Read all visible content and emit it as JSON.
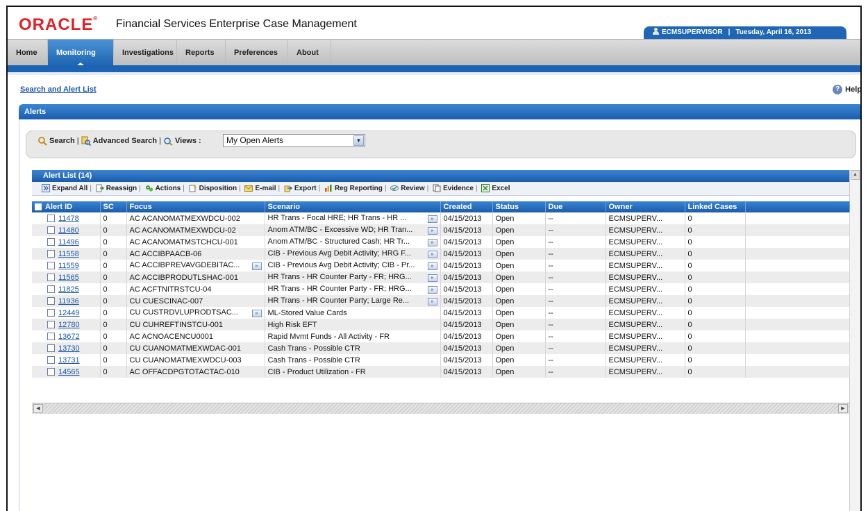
{
  "header": {
    "logo": "ORACLE",
    "app_title": "Financial Services Enterprise Case Management",
    "user": "ECMSUPERVISOR",
    "date": "Tuesday, April 16, 2013"
  },
  "nav": {
    "tabs": [
      {
        "label": "Home"
      },
      {
        "label": "Monitoring",
        "active": true
      },
      {
        "label": "Investigations"
      },
      {
        "label": "Reports"
      },
      {
        "label": "Preferences"
      },
      {
        "label": "About"
      }
    ]
  },
  "breadcrumb": "Search and Alert List",
  "help_label": "Help",
  "alerts_panel": {
    "title": "Alerts",
    "search_label": "Search",
    "advanced_search_label": "Advanced Search",
    "views_label": "Views :",
    "views_selected": "My Open Alerts"
  },
  "alert_list": {
    "title": "Alert List",
    "count": "(14)",
    "toolbar": {
      "expand_all": "Expand All",
      "reassign": "Reassign",
      "actions": "Actions",
      "disposition": "Disposition",
      "email": "E-mail",
      "export": "Export",
      "reg_reporting": "Reg Reporting",
      "review": "Review",
      "evidence": "Evidence",
      "excel": "Excel"
    },
    "columns": {
      "alert_id": "Alert ID",
      "sc": "SC",
      "focus": "Focus",
      "scenario": "Scenario",
      "created": "Created",
      "status": "Status",
      "due": "Due",
      "owner": "Owner",
      "linked_cases": "Linked Cases"
    },
    "rows": [
      {
        "id": "11478",
        "sc": "0",
        "focus": "AC ACANOMATMEXWDCU-002",
        "focus_more": false,
        "scenario": "HR Trans - Focal HRE; HR Trans - HR ...",
        "scenario_more": true,
        "created": "04/15/2013",
        "status": "Open",
        "due": "--",
        "owner": "ECMSUPERV...",
        "linked": "0"
      },
      {
        "id": "11480",
        "sc": "0",
        "focus": "AC ACANOMATMEXWDCU-02",
        "focus_more": false,
        "scenario": "Anom ATM/BC - Excessive WD; HR Tran...",
        "scenario_more": true,
        "created": "04/15/2013",
        "status": "Open",
        "due": "--",
        "owner": "ECMSUPERV...",
        "linked": "0"
      },
      {
        "id": "11496",
        "sc": "0",
        "focus": "AC ACANOMATMSTCHCU-001",
        "focus_more": false,
        "scenario": "Anom ATM/BC - Structured Cash; HR Tr...",
        "scenario_more": true,
        "created": "04/15/2013",
        "status": "Open",
        "due": "--",
        "owner": "ECMSUPERV...",
        "linked": "0"
      },
      {
        "id": "11558",
        "sc": "0",
        "focus": "AC ACCIBPAACB-06",
        "focus_more": false,
        "scenario": "CIB - Previous Avg Debit Activity; HRG F...",
        "scenario_more": true,
        "created": "04/15/2013",
        "status": "Open",
        "due": "--",
        "owner": "ECMSUPERV...",
        "linked": "0"
      },
      {
        "id": "11559",
        "sc": "0",
        "focus": "AC ACCIBPREVAVGDEBITAC...",
        "focus_more": true,
        "scenario": "CIB - Previous Avg Debit Activity; CIB - Pr...",
        "scenario_more": true,
        "created": "04/15/2013",
        "status": "Open",
        "due": "--",
        "owner": "ECMSUPERV...",
        "linked": "0"
      },
      {
        "id": "11565",
        "sc": "0",
        "focus": "AC ACCIBPRODUTLSHAC-001",
        "focus_more": false,
        "scenario": "HR Trans - HR Counter Party - FR; HRG...",
        "scenario_more": true,
        "created": "04/15/2013",
        "status": "Open",
        "due": "--",
        "owner": "ECMSUPERV...",
        "linked": "0"
      },
      {
        "id": "11825",
        "sc": "0",
        "focus": "AC ACFTNITRSTCU-04",
        "focus_more": false,
        "scenario": "HR Trans - HR Counter Party - FR; HRG...",
        "scenario_more": true,
        "created": "04/15/2013",
        "status": "Open",
        "due": "--",
        "owner": "ECMSUPERV...",
        "linked": "0"
      },
      {
        "id": "11936",
        "sc": "0",
        "focus": "CU CUESCINAC-007",
        "focus_more": false,
        "scenario": "HR Trans - HR Counter Party; Large Re...",
        "scenario_more": true,
        "created": "04/15/2013",
        "status": "Open",
        "due": "--",
        "owner": "ECMSUPERV...",
        "linked": "0"
      },
      {
        "id": "12449",
        "sc": "0",
        "focus": "CU CUSTRDVLUPRODTSAC...",
        "focus_more": true,
        "scenario": "ML-Stored Value Cards",
        "scenario_more": false,
        "created": "04/15/2013",
        "status": "Open",
        "due": "--",
        "owner": "ECMSUPERV...",
        "linked": "0"
      },
      {
        "id": "12780",
        "sc": "0",
        "focus": "CU CUHREFTINSTCU-001",
        "focus_more": false,
        "scenario": "High Risk EFT",
        "scenario_more": false,
        "created": "04/15/2013",
        "status": "Open",
        "due": "--",
        "owner": "ECMSUPERV...",
        "linked": "0"
      },
      {
        "id": "13672",
        "sc": "0",
        "focus": "AC ACNOACENCU0001",
        "focus_more": false,
        "scenario": "Rapid Mvmt Funds - All Activity - FR",
        "scenario_more": false,
        "created": "04/15/2013",
        "status": "Open",
        "due": "--",
        "owner": "ECMSUPERV...",
        "linked": "0"
      },
      {
        "id": "13730",
        "sc": "0",
        "focus": "CU CUANOMATMEXWDAC-001",
        "focus_more": false,
        "scenario": "Cash Trans - Possible CTR",
        "scenario_more": false,
        "created": "04/15/2013",
        "status": "Open",
        "due": "--",
        "owner": "ECMSUPERV...",
        "linked": "0"
      },
      {
        "id": "13731",
        "sc": "0",
        "focus": "CU CUANOMATMEXWDCU-003",
        "focus_more": false,
        "scenario": "Cash Trans - Possible CTR",
        "scenario_more": false,
        "created": "04/15/2013",
        "status": "Open",
        "due": "--",
        "owner": "ECMSUPERV...",
        "linked": "0"
      },
      {
        "id": "14565",
        "sc": "0",
        "focus": "AC OFFACDPGTOTACTAC-010",
        "focus_more": false,
        "scenario": "CIB - Product Utilization - FR",
        "scenario_more": false,
        "created": "04/15/2013",
        "status": "Open",
        "due": "--",
        "owner": "ECMSUPERV...",
        "linked": "0"
      }
    ]
  },
  "colors": {
    "oracle_red": "#e01f26",
    "nav_blue": "#1d64b2",
    "link_blue": "#1a55a8"
  }
}
